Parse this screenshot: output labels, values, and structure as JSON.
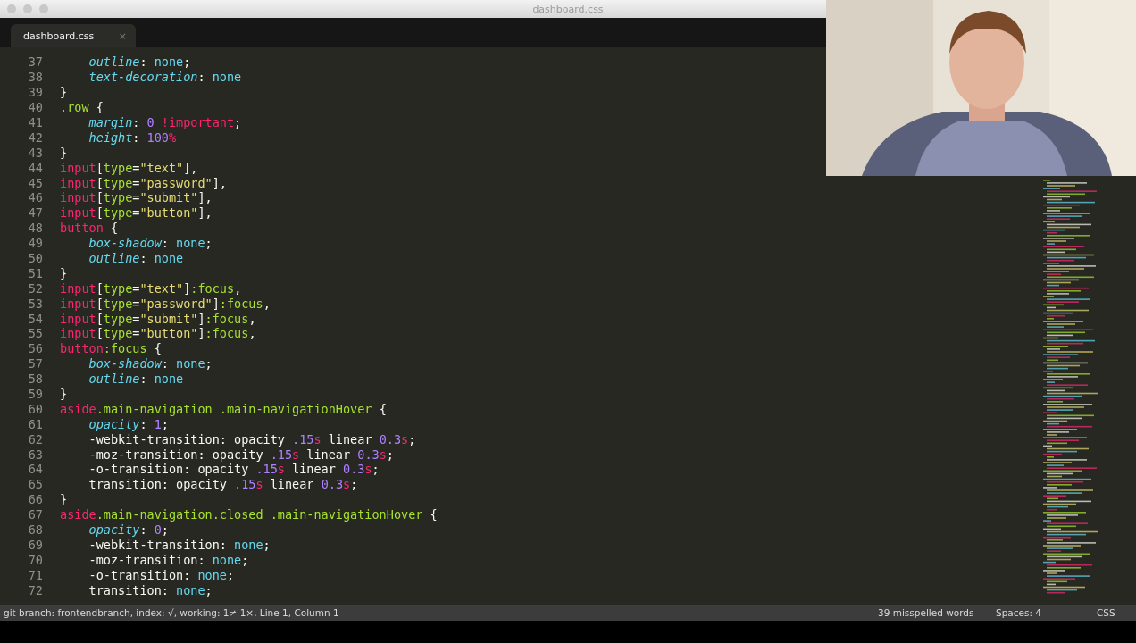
{
  "window": {
    "title": "dashboard.css"
  },
  "tabs": [
    {
      "label": "dashboard.css",
      "close": "×",
      "selected": true
    }
  ],
  "editor": {
    "lines": [
      {
        "number": "37",
        "indent": true,
        "tokens": [
          {
            "kind": "prop",
            "text": "outline"
          },
          {
            "kind": "plain",
            "text": ": "
          },
          {
            "kind": "value",
            "text": "none"
          },
          {
            "kind": "plain",
            "text": ";"
          }
        ]
      },
      {
        "number": "38",
        "indent": true,
        "tokens": [
          {
            "kind": "prop",
            "text": "text-decoration"
          },
          {
            "kind": "plain",
            "text": ": "
          },
          {
            "kind": "value",
            "text": "none"
          }
        ]
      },
      {
        "number": "39",
        "indent": false,
        "tokens": [
          {
            "kind": "plain",
            "text": "}"
          }
        ]
      },
      {
        "number": "40",
        "indent": false,
        "tokens": [
          {
            "kind": "class",
            "text": ".row"
          },
          {
            "kind": "plain",
            "text": " {"
          }
        ]
      },
      {
        "number": "41",
        "indent": true,
        "tokens": [
          {
            "kind": "prop",
            "text": "margin"
          },
          {
            "kind": "plain",
            "text": ": "
          },
          {
            "kind": "number",
            "text": "0"
          },
          {
            "kind": "tag",
            "text": " !important"
          },
          {
            "kind": "plain",
            "text": ";"
          }
        ]
      },
      {
        "number": "42",
        "indent": true,
        "tokens": [
          {
            "kind": "prop",
            "text": "height"
          },
          {
            "kind": "plain",
            "text": ": "
          },
          {
            "kind": "number",
            "text": "100"
          },
          {
            "kind": "tag",
            "text": "%"
          }
        ]
      },
      {
        "number": "43",
        "indent": false,
        "tokens": [
          {
            "kind": "plain",
            "text": "}"
          }
        ]
      },
      {
        "number": "44",
        "indent": false,
        "tokens": [
          {
            "kind": "tag",
            "text": "input"
          },
          {
            "kind": "plain",
            "text": "["
          },
          {
            "kind": "class",
            "text": "type"
          },
          {
            "kind": "plain",
            "text": "="
          },
          {
            "kind": "string",
            "text": "\"text\""
          },
          {
            "kind": "plain",
            "text": "],"
          }
        ]
      },
      {
        "number": "45",
        "indent": false,
        "tokens": [
          {
            "kind": "tag",
            "text": "input"
          },
          {
            "kind": "plain",
            "text": "["
          },
          {
            "kind": "class",
            "text": "type"
          },
          {
            "kind": "plain",
            "text": "="
          },
          {
            "kind": "string",
            "text": "\"password\""
          },
          {
            "kind": "plain",
            "text": "],"
          }
        ]
      },
      {
        "number": "46",
        "indent": false,
        "tokens": [
          {
            "kind": "tag",
            "text": "input"
          },
          {
            "kind": "plain",
            "text": "["
          },
          {
            "kind": "class",
            "text": "type"
          },
          {
            "kind": "plain",
            "text": "="
          },
          {
            "kind": "string",
            "text": "\"submit\""
          },
          {
            "kind": "plain",
            "text": "],"
          }
        ]
      },
      {
        "number": "47",
        "indent": false,
        "tokens": [
          {
            "kind": "tag",
            "text": "input"
          },
          {
            "kind": "plain",
            "text": "["
          },
          {
            "kind": "class",
            "text": "type"
          },
          {
            "kind": "plain",
            "text": "="
          },
          {
            "kind": "string",
            "text": "\"button\""
          },
          {
            "kind": "plain",
            "text": "],"
          }
        ]
      },
      {
        "number": "48",
        "indent": false,
        "tokens": [
          {
            "kind": "tag",
            "text": "button"
          },
          {
            "kind": "plain",
            "text": " {"
          }
        ]
      },
      {
        "number": "49",
        "indent": true,
        "tokens": [
          {
            "kind": "prop",
            "text": "box-shadow"
          },
          {
            "kind": "plain",
            "text": ": "
          },
          {
            "kind": "value",
            "text": "none"
          },
          {
            "kind": "plain",
            "text": ";"
          }
        ]
      },
      {
        "number": "50",
        "indent": true,
        "tokens": [
          {
            "kind": "prop",
            "text": "outline"
          },
          {
            "kind": "plain",
            "text": ": "
          },
          {
            "kind": "value",
            "text": "none"
          }
        ]
      },
      {
        "number": "51",
        "indent": false,
        "tokens": [
          {
            "kind": "plain",
            "text": "}"
          }
        ]
      },
      {
        "number": "52",
        "indent": false,
        "tokens": [
          {
            "kind": "tag",
            "text": "input"
          },
          {
            "kind": "plain",
            "text": "["
          },
          {
            "kind": "class",
            "text": "type"
          },
          {
            "kind": "plain",
            "text": "="
          },
          {
            "kind": "string",
            "text": "\"text\""
          },
          {
            "kind": "plain",
            "text": "]"
          },
          {
            "kind": "class",
            "text": ":focus"
          },
          {
            "kind": "plain",
            "text": ","
          }
        ]
      },
      {
        "number": "53",
        "indent": false,
        "tokens": [
          {
            "kind": "tag",
            "text": "input"
          },
          {
            "kind": "plain",
            "text": "["
          },
          {
            "kind": "class",
            "text": "type"
          },
          {
            "kind": "plain",
            "text": "="
          },
          {
            "kind": "string",
            "text": "\"password\""
          },
          {
            "kind": "plain",
            "text": "]"
          },
          {
            "kind": "class",
            "text": ":focus"
          },
          {
            "kind": "plain",
            "text": ","
          }
        ]
      },
      {
        "number": "54",
        "indent": false,
        "tokens": [
          {
            "kind": "tag",
            "text": "input"
          },
          {
            "kind": "plain",
            "text": "["
          },
          {
            "kind": "class",
            "text": "type"
          },
          {
            "kind": "plain",
            "text": "="
          },
          {
            "kind": "string",
            "text": "\"submit\""
          },
          {
            "kind": "plain",
            "text": "]"
          },
          {
            "kind": "class",
            "text": ":focus"
          },
          {
            "kind": "plain",
            "text": ","
          }
        ]
      },
      {
        "number": "55",
        "indent": false,
        "tokens": [
          {
            "kind": "tag",
            "text": "input"
          },
          {
            "kind": "plain",
            "text": "["
          },
          {
            "kind": "class",
            "text": "type"
          },
          {
            "kind": "plain",
            "text": "="
          },
          {
            "kind": "string",
            "text": "\"button\""
          },
          {
            "kind": "plain",
            "text": "]"
          },
          {
            "kind": "class",
            "text": ":focus"
          },
          {
            "kind": "plain",
            "text": ","
          }
        ]
      },
      {
        "number": "56",
        "indent": false,
        "tokens": [
          {
            "kind": "tag",
            "text": "button"
          },
          {
            "kind": "class",
            "text": ":focus"
          },
          {
            "kind": "plain",
            "text": " {"
          }
        ]
      },
      {
        "number": "57",
        "indent": true,
        "tokens": [
          {
            "kind": "prop",
            "text": "box-shadow"
          },
          {
            "kind": "plain",
            "text": ": "
          },
          {
            "kind": "value",
            "text": "none"
          },
          {
            "kind": "plain",
            "text": ";"
          }
        ]
      },
      {
        "number": "58",
        "indent": true,
        "tokens": [
          {
            "kind": "prop",
            "text": "outline"
          },
          {
            "kind": "plain",
            "text": ": "
          },
          {
            "kind": "value",
            "text": "none"
          }
        ]
      },
      {
        "number": "59",
        "indent": false,
        "tokens": [
          {
            "kind": "plain",
            "text": "}"
          }
        ]
      },
      {
        "number": "60",
        "indent": false,
        "tokens": [
          {
            "kind": "tag",
            "text": "aside"
          },
          {
            "kind": "class",
            "text": ".main-navigation .main-navigationHover"
          },
          {
            "kind": "plain",
            "text": " {"
          }
        ]
      },
      {
        "number": "61",
        "indent": true,
        "tokens": [
          {
            "kind": "prop",
            "text": "opacity"
          },
          {
            "kind": "plain",
            "text": ": "
          },
          {
            "kind": "number",
            "text": "1"
          },
          {
            "kind": "plain",
            "text": ";"
          }
        ]
      },
      {
        "number": "62",
        "indent": true,
        "tokens": [
          {
            "kind": "plain",
            "text": "-webkit-transition: opacity "
          },
          {
            "kind": "number",
            "text": ".15"
          },
          {
            "kind": "tag",
            "text": "s"
          },
          {
            "kind": "plain",
            "text": " linear "
          },
          {
            "kind": "number",
            "text": "0.3"
          },
          {
            "kind": "tag",
            "text": "s"
          },
          {
            "kind": "plain",
            "text": ";"
          }
        ]
      },
      {
        "number": "63",
        "indent": true,
        "tokens": [
          {
            "kind": "plain",
            "text": "-moz-transition: opacity "
          },
          {
            "kind": "number",
            "text": ".15"
          },
          {
            "kind": "tag",
            "text": "s"
          },
          {
            "kind": "plain",
            "text": " linear "
          },
          {
            "kind": "number",
            "text": "0.3"
          },
          {
            "kind": "tag",
            "text": "s"
          },
          {
            "kind": "plain",
            "text": ";"
          }
        ]
      },
      {
        "number": "64",
        "indent": true,
        "tokens": [
          {
            "kind": "plain",
            "text": "-o-transition: opacity "
          },
          {
            "kind": "number",
            "text": ".15"
          },
          {
            "kind": "tag",
            "text": "s"
          },
          {
            "kind": "plain",
            "text": " linear "
          },
          {
            "kind": "number",
            "text": "0.3"
          },
          {
            "kind": "tag",
            "text": "s"
          },
          {
            "kind": "plain",
            "text": ";"
          }
        ]
      },
      {
        "number": "65",
        "indent": true,
        "tokens": [
          {
            "kind": "plain",
            "text": "transition: opacity "
          },
          {
            "kind": "number",
            "text": ".15"
          },
          {
            "kind": "tag",
            "text": "s"
          },
          {
            "kind": "plain",
            "text": " linear "
          },
          {
            "kind": "number",
            "text": "0.3"
          },
          {
            "kind": "tag",
            "text": "s"
          },
          {
            "kind": "plain",
            "text": ";"
          }
        ]
      },
      {
        "number": "66",
        "indent": false,
        "tokens": [
          {
            "kind": "plain",
            "text": "}"
          }
        ]
      },
      {
        "number": "67",
        "indent": false,
        "tokens": [
          {
            "kind": "tag",
            "text": "aside"
          },
          {
            "kind": "class",
            "text": ".main-navigation.closed .main-navigationHover"
          },
          {
            "kind": "plain",
            "text": " {"
          }
        ]
      },
      {
        "number": "68",
        "indent": true,
        "tokens": [
          {
            "kind": "prop",
            "text": "opacity"
          },
          {
            "kind": "plain",
            "text": ": "
          },
          {
            "kind": "number",
            "text": "0"
          },
          {
            "kind": "plain",
            "text": ";"
          }
        ]
      },
      {
        "number": "69",
        "indent": true,
        "tokens": [
          {
            "kind": "plain",
            "text": "-webkit-transition: "
          },
          {
            "kind": "value",
            "text": "none"
          },
          {
            "kind": "plain",
            "text": ";"
          }
        ]
      },
      {
        "number": "70",
        "indent": true,
        "tokens": [
          {
            "kind": "plain",
            "text": "-moz-transition: "
          },
          {
            "kind": "value",
            "text": "none"
          },
          {
            "kind": "plain",
            "text": ";"
          }
        ]
      },
      {
        "number": "71",
        "indent": true,
        "tokens": [
          {
            "kind": "plain",
            "text": "-o-transition: "
          },
          {
            "kind": "value",
            "text": "none"
          },
          {
            "kind": "plain",
            "text": ";"
          }
        ]
      },
      {
        "number": "72",
        "indent": true,
        "tokens": [
          {
            "kind": "plain",
            "text": "transition: "
          },
          {
            "kind": "value",
            "text": "none"
          },
          {
            "kind": "plain",
            "text": ";"
          }
        ]
      }
    ]
  },
  "status_bar": {
    "left": "git branch: frontendbranch, index: √, working: 1≠ 1×, Line 1, Column 1",
    "spelling": "39 misspelled words",
    "spaces": "Spaces: 4",
    "syntax": "CSS"
  }
}
